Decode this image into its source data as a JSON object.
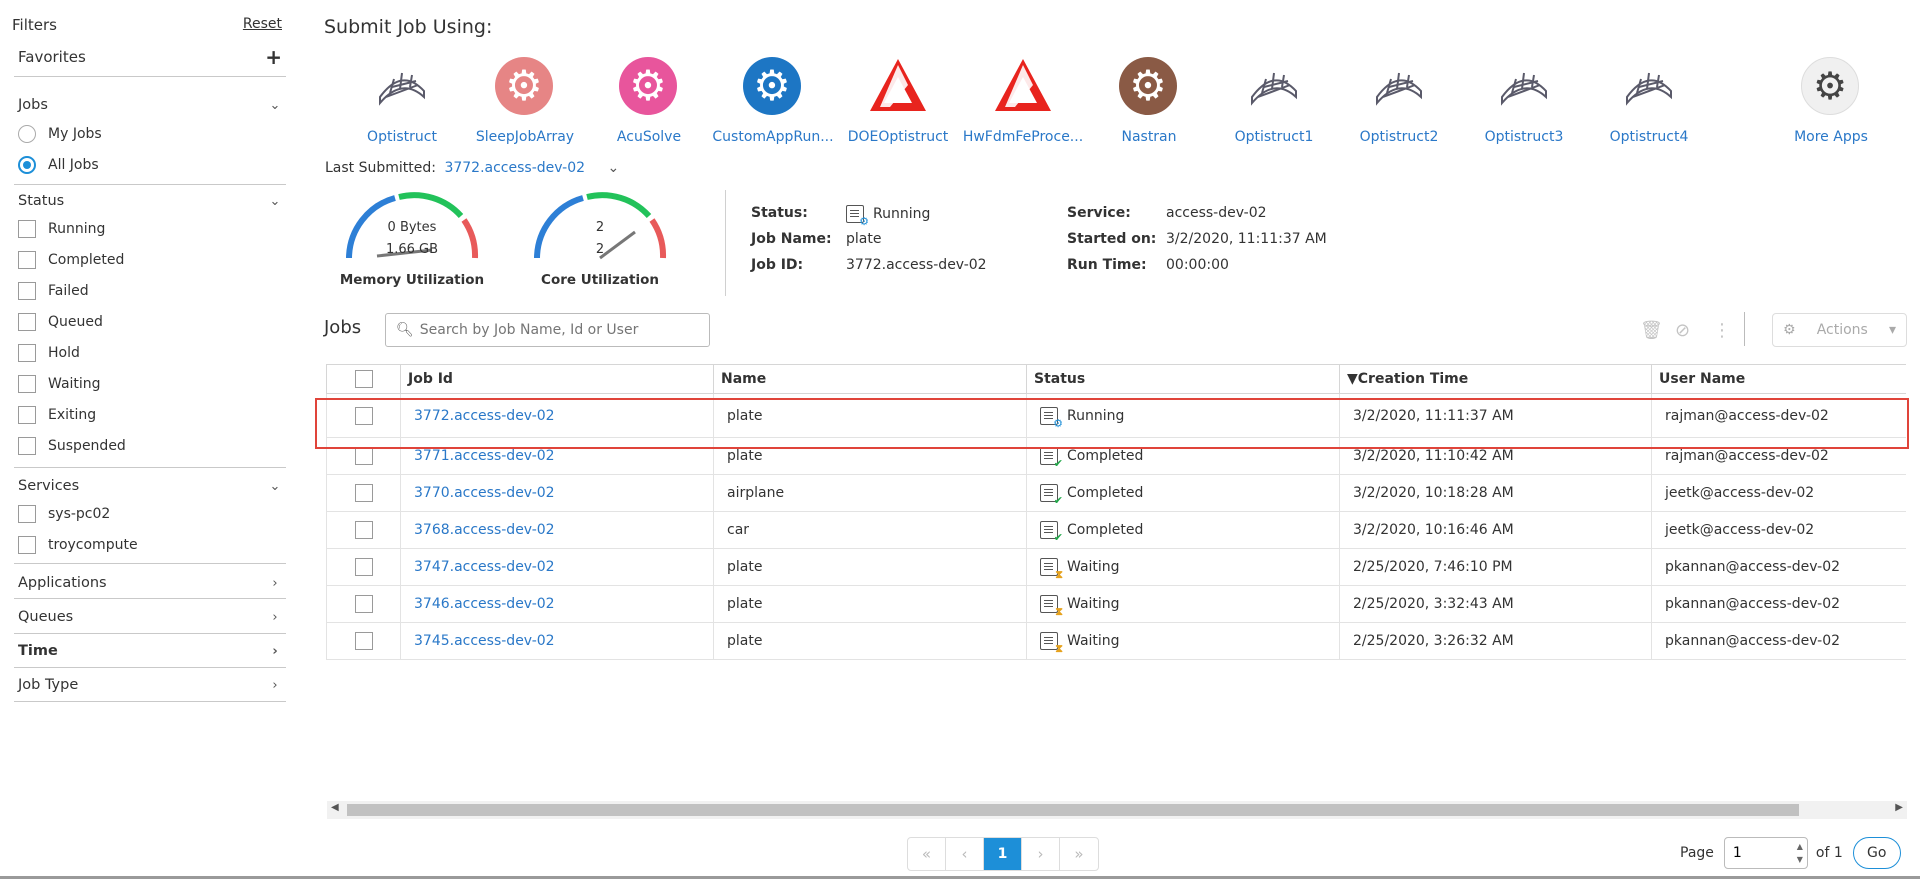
{
  "sidebar": {
    "filters_label": "Filters",
    "reset_label": "Reset",
    "favorites_label": "Favorites",
    "add_icon": "plus-icon",
    "jobs": {
      "title": "Jobs",
      "options": [
        {
          "label": "My Jobs",
          "selected": false
        },
        {
          "label": "All Jobs",
          "selected": true
        }
      ]
    },
    "status": {
      "title": "Status",
      "items": [
        "Running",
        "Completed",
        "Failed",
        "Queued",
        "Hold",
        "Waiting",
        "Exiting",
        "Suspended"
      ]
    },
    "services": {
      "title": "Services",
      "items": [
        "sys-pc02",
        "troycompute"
      ]
    },
    "collapsed_sections": [
      "Applications",
      "Queues",
      "Time",
      "Job Type"
    ]
  },
  "submit": {
    "title": "Submit Job Using:",
    "apps": [
      {
        "label": "Optistruct",
        "icon": "mesh-icon"
      },
      {
        "label": "SleepJobArray",
        "icon": "gear-icon"
      },
      {
        "label": "AcuSolve",
        "icon": "gear-icon"
      },
      {
        "label": "CustomAppRun...",
        "icon": "gear-icon"
      },
      {
        "label": "DOEOptistruct",
        "icon": "altair-logo-icon"
      },
      {
        "label": "HwFdmFeProce...",
        "icon": "altair-logo-icon"
      },
      {
        "label": "Nastran",
        "icon": "gear-icon"
      },
      {
        "label": "Optistruct1",
        "icon": "mesh-icon"
      },
      {
        "label": "Optistruct2",
        "icon": "mesh-icon"
      },
      {
        "label": "Optistruct3",
        "icon": "mesh-icon"
      },
      {
        "label": "Optistruct4",
        "icon": "mesh-icon"
      },
      {
        "label": "More Apps",
        "icon": "gears-icon"
      }
    ],
    "colors": {
      "sleep": "#e68585",
      "acusolve": "#e8559c",
      "custom": "#1d76c4",
      "altair": "#e8241e",
      "nastran": "#8a5a45"
    }
  },
  "last_submitted": {
    "label": "Last Submitted:",
    "value": "3772.access-dev-02"
  },
  "memory": {
    "used": "0 Bytes",
    "total": "1.66 GB",
    "caption": "Memory Utilization"
  },
  "core": {
    "used": "2",
    "total": "2",
    "caption": "Core Utilization"
  },
  "job_info": {
    "status_label": "Status:",
    "status_value": "Running",
    "name_label": "Job Name:",
    "name_value": "plate",
    "id_label": "Job ID:",
    "id_value": "3772.access-dev-02",
    "service_label": "Service:",
    "service_value": "access-dev-02",
    "started_label": "Started on:",
    "started_value": "3/2/2020, 11:11:37 AM",
    "runtime_label": "Run Time:",
    "runtime_value": "00:00:00"
  },
  "jobs_list": {
    "title": "Jobs",
    "search_placeholder": "Search by Job Name, Id or User",
    "actions_label": "Actions",
    "columns": [
      "Job Id",
      "Name",
      "Status",
      "▼Creation Time",
      "User Name"
    ],
    "rows": [
      {
        "id": "3772.access-dev-02",
        "name": "plate",
        "status": "Running",
        "status_icon": "running-icon",
        "created": "3/2/2020, 11:11:37 AM",
        "user": "rajman@access-dev-02"
      },
      {
        "id": "3771.access-dev-02",
        "name": "plate",
        "status": "Completed",
        "status_icon": "completed-icon",
        "created": "3/2/2020, 11:10:42 AM",
        "user": "rajman@access-dev-02"
      },
      {
        "id": "3770.access-dev-02",
        "name": "airplane",
        "status": "Completed",
        "status_icon": "completed-icon",
        "created": "3/2/2020, 10:18:28 AM",
        "user": "jeetk@access-dev-02"
      },
      {
        "id": "3768.access-dev-02",
        "name": "car",
        "status": "Completed",
        "status_icon": "completed-icon",
        "created": "3/2/2020, 10:16:46 AM",
        "user": "jeetk@access-dev-02"
      },
      {
        "id": "3747.access-dev-02",
        "name": "plate",
        "status": "Waiting",
        "status_icon": "waiting-icon",
        "created": "2/25/2020, 7:46:10 PM",
        "user": "pkannan@access-dev-02"
      },
      {
        "id": "3746.access-dev-02",
        "name": "plate",
        "status": "Waiting",
        "status_icon": "waiting-icon",
        "created": "2/25/2020, 3:32:43 AM",
        "user": "pkannan@access-dev-02"
      },
      {
        "id": "3745.access-dev-02",
        "name": "plate",
        "status": "Waiting",
        "status_icon": "waiting-icon",
        "created": "2/25/2020, 3:26:32 AM",
        "user": "pkannan@access-dev-02"
      }
    ]
  },
  "pagination": {
    "first": "«",
    "prev": "‹",
    "current": "1",
    "next": "›",
    "last": "»",
    "page_label": "Page",
    "page_value": "1",
    "of_label": "of 1",
    "go_label": "Go"
  }
}
